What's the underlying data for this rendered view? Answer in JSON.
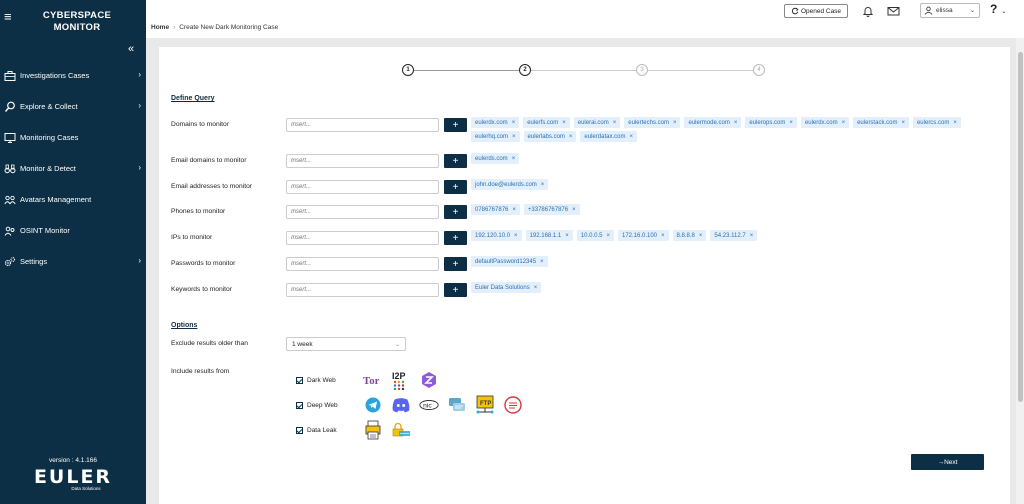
{
  "sidebar": {
    "brand_line1": "CYBERSPACE",
    "brand_line2": "MONITOR",
    "items": [
      {
        "label": "Investigations Cases",
        "chevron": true
      },
      {
        "label": "Explore & Collect",
        "chevron": true
      },
      {
        "label": "Monitoring Cases",
        "chevron": false
      },
      {
        "label": "Monitor & Detect",
        "chevron": true
      },
      {
        "label": "Avatars Management",
        "chevron": false
      },
      {
        "label": "OSINT Monitor",
        "chevron": false
      },
      {
        "label": "Settings",
        "chevron": true
      }
    ],
    "version": "version : 4.1.166",
    "logo": "EULER",
    "logo_sub": "Data Solutions"
  },
  "topbar": {
    "breadcrumb_home": "Home",
    "breadcrumb_current": "Create New Dark Monitoring Case",
    "opened_case_label": "Opened Case",
    "username": "elissa",
    "help": "?"
  },
  "stepper": {
    "steps": [
      "1",
      "2",
      "3",
      "4"
    ],
    "active_steps": [
      "1",
      "2"
    ]
  },
  "define_query": {
    "title": "Define Query",
    "placeholder": "Insert...",
    "rows": [
      {
        "label": "Domains to monitor",
        "tags": [
          "eulerdx.com",
          "eulerfs.com",
          "eulerai.com",
          "eulertechs.com",
          "eulermode.com",
          "eulerops.com",
          "eulerdx.com",
          "eulerstack.com",
          "eulercs.com",
          "eulerhq.com",
          "eulerlabs.com",
          "eulerdatax.com"
        ]
      },
      {
        "label": "Email domains to monitor",
        "tags": [
          "eulerds.com"
        ]
      },
      {
        "label": "Email addresses to monitor",
        "tags": [
          "john.doe@eulerds.com"
        ]
      },
      {
        "label": "Phones to monitor",
        "tags": [
          "0786767876",
          "+33786767876"
        ]
      },
      {
        "label": "IPs to monitor",
        "tags": [
          "192.120.10.0",
          "192.168.1.1",
          "10.0.0.5",
          "172.16.0.100",
          "8.8.8.8",
          "54.23.112.7"
        ]
      },
      {
        "label": "Passwords to monitor",
        "tags": [
          "defaultPassword12345"
        ]
      },
      {
        "label": "Keywords to monitor",
        "tags": [
          "Euler Data Solutions"
        ]
      }
    ]
  },
  "options": {
    "title": "Options",
    "exclude_label": "Exclude results older than",
    "exclude_value": "1 week",
    "include_label": "Include results from",
    "sources": [
      {
        "label": "Dark Web",
        "checked": true,
        "icons": [
          "tor-icon",
          "i2p-icon",
          "zeronet-icon"
        ]
      },
      {
        "label": "Deep Web",
        "checked": true,
        "icons": [
          "telegram-icon",
          "discord-icon",
          "nic-icon",
          "forum-icon",
          "ftp-icon",
          "paste-icon"
        ]
      },
      {
        "label": "Data Leak",
        "checked": true,
        "icons": [
          "leak-printer-icon",
          "leak-lock-icon"
        ]
      }
    ]
  },
  "next_label": "→Next",
  "i2p_text": "I2P",
  "tor_text": "Tor",
  "nic_text": "nic",
  "ftp_text": "FTP",
  "colors": {
    "sidebar": "#0d2f45",
    "accent": "#0d2f45",
    "tag_bg": "#e3f0fb",
    "tag_text": "#2b6fb3"
  }
}
